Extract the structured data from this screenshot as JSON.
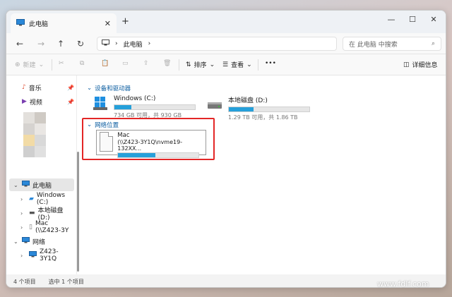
{
  "window": {
    "tab_title": "此电脑",
    "new_tab": "+",
    "minimize": "—",
    "maximize": "☐",
    "close": "✕"
  },
  "address": {
    "path_root": "此电脑",
    "path_chevron": "›",
    "search_placeholder": "在 此电脑 中搜索"
  },
  "toolbar": {
    "new_label": "新建",
    "sort_label": "排序",
    "view_label": "查看",
    "more_label": "•••",
    "details_label": "详细信息"
  },
  "sidebar": {
    "quick": [
      {
        "label": "音乐"
      },
      {
        "label": "视频"
      }
    ],
    "thispc": {
      "label": "此电脑"
    },
    "thispc_children": [
      {
        "label": "Windows (C:)"
      },
      {
        "label": "本地磁盘 (D:)"
      },
      {
        "label": "Mac (\\\\Z423-3Y"
      }
    ],
    "network": {
      "label": "网络"
    },
    "network_children": [
      {
        "label": "Z423-3Y1Q"
      }
    ]
  },
  "content": {
    "devices_header": "设备和驱动器",
    "network_header": "网络位置",
    "drives": [
      {
        "name": "Windows (C:)",
        "info": "734 GB 可用，共 930 GB",
        "used_fraction": 0.21
      },
      {
        "name": "本地磁盘 (D:)",
        "info": "1.29 TB 可用，共 1.86 TB",
        "used_fraction": 0.31
      }
    ],
    "network_location": {
      "name_line1": "Mac",
      "name_line2": "(\\\\Z423-3Y1Q\\nvme19-132XX...",
      "used_fraction": 0.46
    }
  },
  "status": {
    "items": "4 个项目",
    "selected": "选中 1 个项目"
  },
  "watermark": "www.fdlf.com",
  "colors": {
    "accent": "#26a0da",
    "highlight": "#e32626"
  }
}
